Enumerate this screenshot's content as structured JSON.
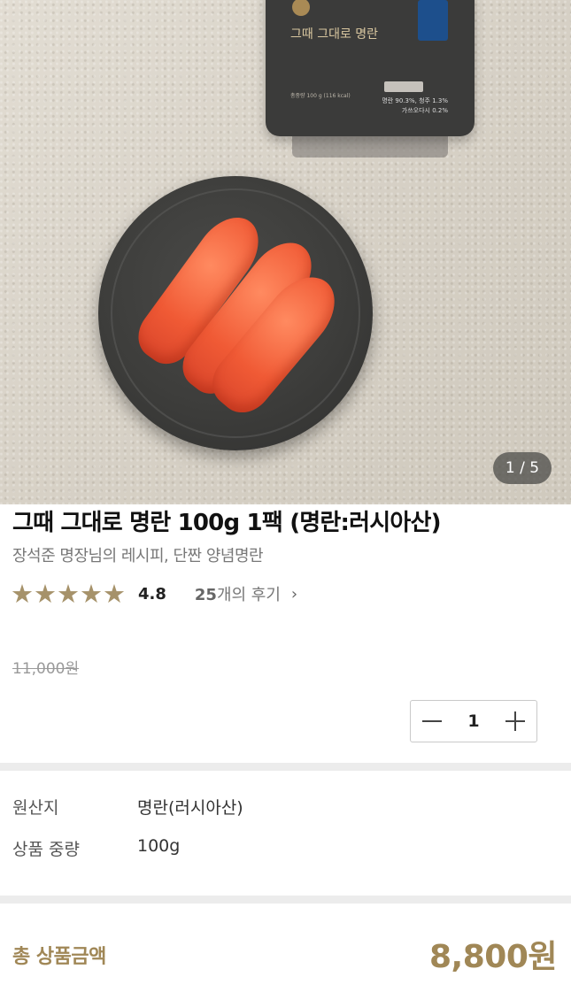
{
  "gallery": {
    "counter": "1 / 5",
    "package": {
      "title": "그때 그대로 명란",
      "net_weight": "총중량 100 g (116 kcal)",
      "ingredients": [
        "명란 90.3%, 청주 1.3%",
        "가쓰오다시 0.2%"
      ]
    }
  },
  "product": {
    "title": "그때 그대로 명란 100g 1팩 (명란:러시아산)",
    "subtitle": "장석준 명장님의 레시피, 단짠 양념명란",
    "rating": {
      "stars": "★★★★★",
      "score": "4.8",
      "review_count": "25",
      "review_suffix": "개의 후기",
      "chevron": "›"
    },
    "original_price": "11,000원"
  },
  "quantity": {
    "value": "1"
  },
  "specs": [
    {
      "label": "원산지",
      "value": "명란(러시아산)"
    },
    {
      "label": "상품 중량",
      "value": "100g"
    }
  ],
  "total": {
    "label": "총 상품금액",
    "price": "8,800원"
  },
  "colors": {
    "accent_gold": "#a08756",
    "star": "#a6926a"
  }
}
